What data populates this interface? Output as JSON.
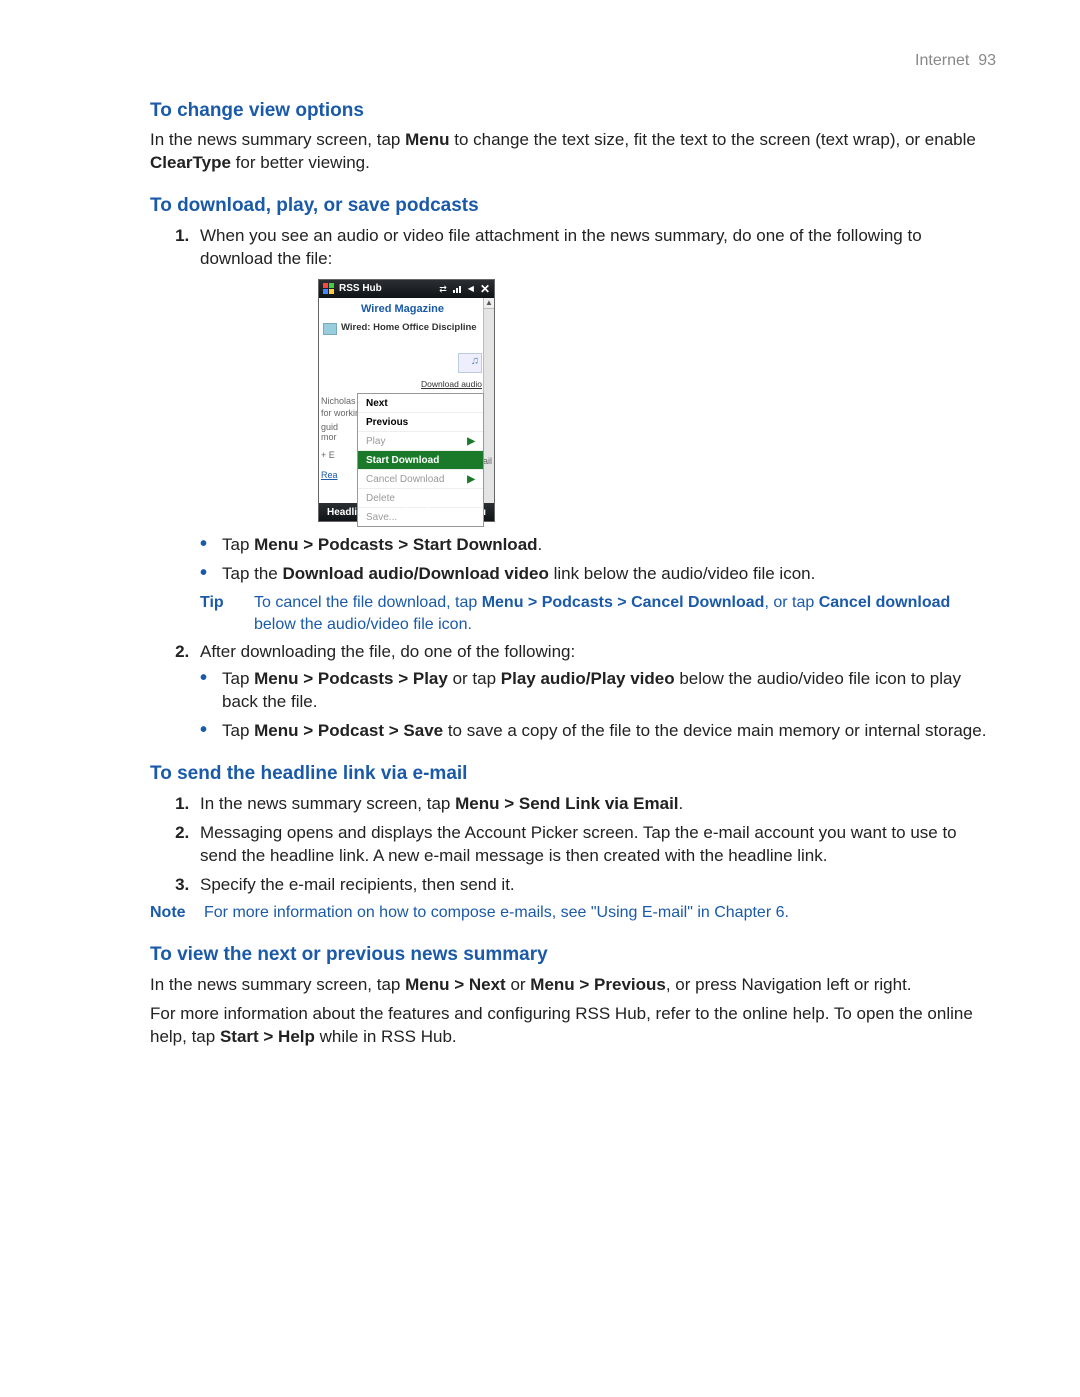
{
  "header": {
    "section": "Internet",
    "page_number": "93"
  },
  "s1": {
    "heading": "To change view options",
    "p1a": "In the news summary screen, tap ",
    "p1b": "Menu",
    "p1c": " to change the text size, fit the text to the screen (text wrap), or enable ",
    "p1d": "ClearType",
    "p1e": " for better viewing."
  },
  "s2": {
    "heading": "To download, play, or save podcasts",
    "li1": "When you see an audio or video file attachment in the news summary, do one of the following to download the file:",
    "shot": {
      "app_title": "RSS Hub",
      "magazine": "Wired Magazine",
      "article": "Wired: Home Office Discipline",
      "download_link": "Download audio",
      "behind1": "Nicholas T",
      "behind2": "for workin",
      "behind3": "guid",
      "behind4": "mor",
      "behind5": "+ E",
      "behind6": "Rea",
      "mail": "mail",
      "popup": {
        "next": "Next",
        "previous": "Previous",
        "play": "Play",
        "start_download": "Start Download",
        "cancel_download": "Cancel Download",
        "delete": "Delete",
        "save": "Save..."
      },
      "soft_left": "Headlines",
      "soft_right": "Menu"
    },
    "b1a": "Tap ",
    "b1b": "Menu > Podcasts > Start Download",
    "b1c": ".",
    "b2a": "Tap the ",
    "b2b": "Download audio/Download video",
    "b2c": " link below the audio/video file icon.",
    "tip_label": "Tip",
    "tip_a": "To cancel the file download, tap ",
    "tip_b": "Menu > Podcasts > Cancel Download",
    "tip_c": ", or tap ",
    "tip_d": "Cancel download",
    "tip_e": " below the audio/video file icon.",
    "li2": "After downloading the file, do one of the following:",
    "b3a": "Tap ",
    "b3b": "Menu > Podcasts > Play",
    "b3c": " or tap ",
    "b3d": "Play audio/Play video",
    "b3e": " below the audio/video file icon to play back the file.",
    "b4a": "Tap ",
    "b4b": "Menu > Podcast > Save",
    "b4c": " to save a copy of the file to the device main memory or internal storage."
  },
  "s3": {
    "heading": "To send the headline link via e-mail",
    "li1a": "In the news summary screen, tap ",
    "li1b": "Menu > Send Link via Email",
    "li1c": ".",
    "li2": "Messaging opens and displays the Account Picker screen. Tap the e-mail account you want to use to send the headline link. A new e-mail message is then created with the headline link.",
    "li3": "Specify the e-mail recipients, then send it.",
    "note_label": "Note",
    "note_text": "For more information on how to compose e-mails, see \"Using E-mail\" in Chapter 6."
  },
  "s4": {
    "heading": "To view the next or previous news summary",
    "p1a": "In the news summary screen, tap ",
    "p1b": "Menu > Next",
    "p1c": " or ",
    "p1d": "Menu > Previous",
    "p1e": ", or press Navigation left or right.",
    "p2a": "For more information about the features and configuring RSS Hub, refer to the online help. To open the online help, tap ",
    "p2b": "Start > Help",
    "p2c": " while in RSS Hub."
  }
}
